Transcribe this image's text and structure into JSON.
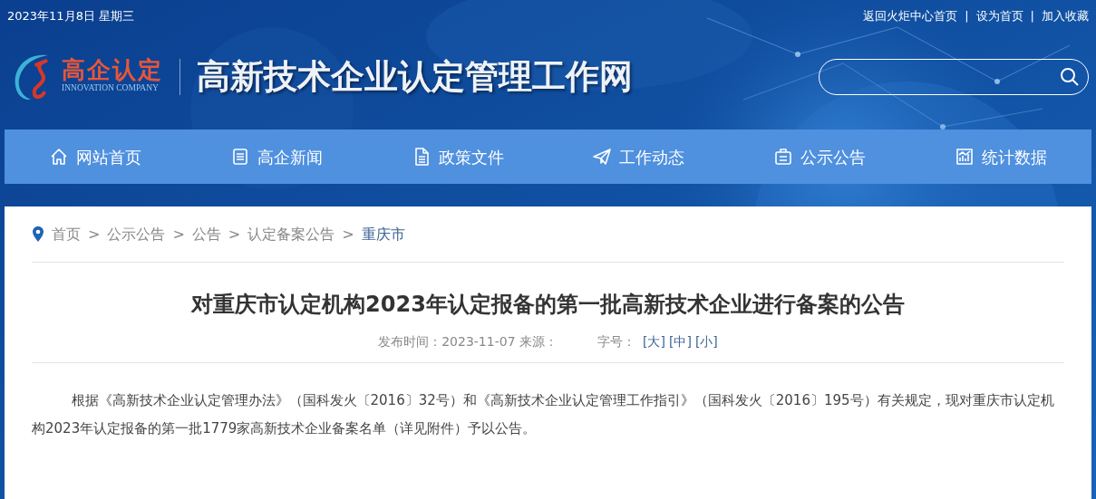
{
  "top_bar": {
    "date": "2023年11月8日 星期三",
    "links": [
      "返回火炬中心首页",
      "设为首页",
      "加入收藏"
    ],
    "separator": "|"
  },
  "logo": {
    "name": "高企认定",
    "subtitle": "INNOVATION COMPANY"
  },
  "site_title": "高新技术企业认定管理工作网",
  "nav": [
    {
      "label": "网站首页",
      "kind": "home"
    },
    {
      "label": "高企新闻",
      "kind": "news"
    },
    {
      "label": "政策文件",
      "kind": "document"
    },
    {
      "label": "工作动态",
      "kind": "send"
    },
    {
      "label": "公示公告",
      "kind": "notice"
    },
    {
      "label": "统计数据",
      "kind": "chart"
    }
  ],
  "breadcrumb": [
    {
      "label": "首页",
      "current": false
    },
    {
      "label": "公示公告",
      "current": false
    },
    {
      "label": "公告",
      "current": false
    },
    {
      "label": "认定备案公告",
      "current": false
    },
    {
      "label": "重庆市",
      "current": true
    }
  ],
  "breadcrumb_separator": ">",
  "article": {
    "title": "对重庆市认定机构2023年认定报备的第一批高新技术企业进行备案的公告",
    "meta": "发布时间：2023-11-07 来源：",
    "font_size_label": "字号：",
    "font_sizes": [
      "[大]",
      "[中]",
      "[小]"
    ],
    "body": "根据《高新技术企业认定管理办法》（国科发火〔2016〕32号）和《高新技术企业认定管理工作指引》（国科发火〔2016〕195号）有关规定，现对重庆市认定机构2023年认定报备的第一批1779家高新技术企业备案名单（详见附件）予以公告。"
  }
}
